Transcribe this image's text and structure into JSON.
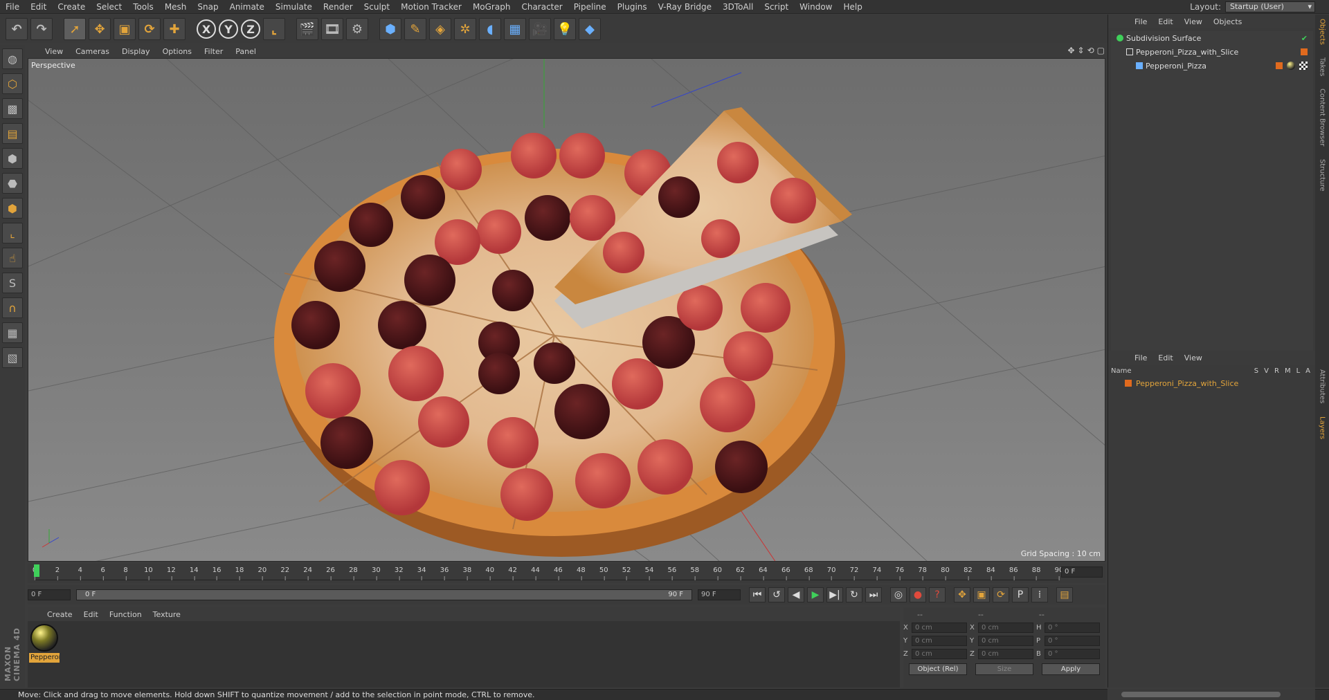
{
  "menu": [
    "File",
    "Edit",
    "Create",
    "Select",
    "Tools",
    "Mesh",
    "Snap",
    "Animate",
    "Simulate",
    "Render",
    "Sculpt",
    "Motion Tracker",
    "MoGraph",
    "Character",
    "Pipeline",
    "Plugins",
    "V-Ray Bridge",
    "3DToAll",
    "Script",
    "Window",
    "Help"
  ],
  "layout": {
    "label": "Layout:",
    "value": "Startup (User)"
  },
  "viewport": {
    "menu": [
      "View",
      "Cameras",
      "Display",
      "Options",
      "Filter",
      "Panel"
    ],
    "label": "Perspective",
    "grid_spacing": "Grid Spacing : 10 cm"
  },
  "timeline": {
    "ticks": [
      "0",
      "2",
      "4",
      "6",
      "8",
      "10",
      "12",
      "14",
      "16",
      "18",
      "20",
      "22",
      "24",
      "26",
      "28",
      "30",
      "32",
      "34",
      "36",
      "38",
      "40",
      "42",
      "44",
      "46",
      "48",
      "50",
      "52",
      "54",
      "56",
      "58",
      "60",
      "62",
      "64",
      "66",
      "68",
      "70",
      "72",
      "74",
      "76",
      "78",
      "80",
      "82",
      "84",
      "86",
      "88",
      "90"
    ],
    "current_frame": "0 F",
    "start": "0 F",
    "range_start": "0 F",
    "range_end": "90 F",
    "end": "90 F"
  },
  "material": {
    "menu": [
      "Create",
      "Edit",
      "Function",
      "Texture"
    ],
    "name": "Pepperoni_Pizza"
  },
  "coords": {
    "header": [
      "--",
      "--",
      "--"
    ],
    "rows": [
      {
        "a": "X",
        "av": "0 cm",
        "b": "X",
        "bv": "0 cm",
        "c": "H",
        "cv": "0 °"
      },
      {
        "a": "Y",
        "av": "0 cm",
        "b": "Y",
        "bv": "0 cm",
        "c": "P",
        "cv": "0 °"
      },
      {
        "a": "Z",
        "av": "0 cm",
        "b": "Z",
        "bv": "0 cm",
        "c": "B",
        "cv": "0 °"
      }
    ],
    "mode": "Object (Rel)",
    "size": "Size",
    "apply": "Apply"
  },
  "objects": {
    "menu": [
      "File",
      "Edit",
      "View",
      "Objects"
    ],
    "items": [
      {
        "name": "Subdivision Surface",
        "indent": 0
      },
      {
        "name": "Pepperoni_Pizza_with_Slice",
        "indent": 1
      },
      {
        "name": "Pepperoni_Pizza",
        "indent": 2
      }
    ]
  },
  "layers": {
    "menu": [
      "File",
      "Edit",
      "View"
    ],
    "header_name": "Name",
    "cols": [
      "S",
      "V",
      "R",
      "M",
      "L",
      "A"
    ],
    "item": "Pepperoni_Pizza_with_Slice"
  },
  "sidetabs": [
    "Objects",
    "Takes",
    "Content Browser",
    "Structure",
    "Attributes",
    "Layers"
  ],
  "status": "Move: Click and drag to move elements. Hold down SHIFT to quantize movement / add to the selection in point mode, CTRL to remove.",
  "brand": "MAXON CINEMA 4D",
  "colors": {
    "accent": "#e2a43b",
    "playhead": "#3fd05a",
    "layer_tag": "#e06a1e"
  }
}
